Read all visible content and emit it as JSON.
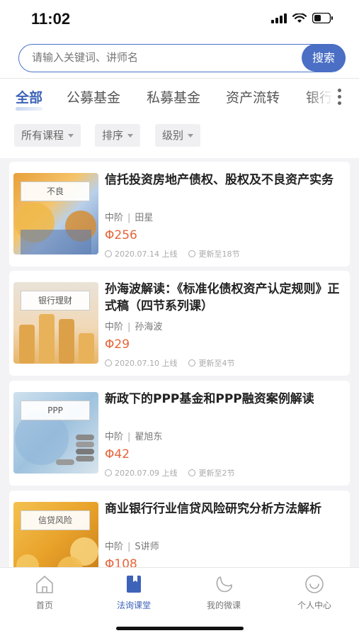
{
  "status": {
    "time": "11:02"
  },
  "search": {
    "placeholder": "请输入关键词、讲师名",
    "button": "搜索"
  },
  "tabs": [
    {
      "label": "全部",
      "active": true
    },
    {
      "label": "公募基金"
    },
    {
      "label": "私募基金"
    },
    {
      "label": "资产流转"
    },
    {
      "label": "银行"
    }
  ],
  "filters": [
    {
      "label": "所有课程"
    },
    {
      "label": "排序"
    },
    {
      "label": "级别"
    }
  ],
  "courses": [
    {
      "thumb_label": "不良",
      "title": "信托投资房地产债权、股权及不良资产实务",
      "level": "中阶",
      "lecturer": "田星",
      "price": "Φ256",
      "online_date": "2020.07.14 上线",
      "updated": "更新至18节"
    },
    {
      "thumb_label": "银行理财",
      "title": "孙海波解读：《标准化债权资产认定规则》正式稿（四节系列课）",
      "level": "中阶",
      "lecturer": "孙海波",
      "price": "Φ29",
      "online_date": "2020.07.10 上线",
      "updated": "更新至4节"
    },
    {
      "thumb_label": "PPP",
      "title": "新政下的PPP基金和PPP融资案例解读",
      "level": "中阶",
      "lecturer": "翟旭东",
      "price": "Φ42",
      "online_date": "2020.07.09 上线",
      "updated": "更新至2节"
    },
    {
      "thumb_label": "信贷风险",
      "title": "商业银行行业信贷风险研究分析方法解析",
      "level": "中阶",
      "lecturer": "S讲师",
      "price": "Φ108",
      "online_date": "",
      "updated": ""
    }
  ],
  "nav": [
    {
      "label": "首页",
      "icon": "home-icon"
    },
    {
      "label": "法询课堂",
      "icon": "classroom-icon",
      "active": true
    },
    {
      "label": "我的微课",
      "icon": "my-course-icon"
    },
    {
      "label": "个人中心",
      "icon": "profile-icon"
    }
  ],
  "colors": {
    "accent": "#3d63b8",
    "price": "#e8643a"
  }
}
